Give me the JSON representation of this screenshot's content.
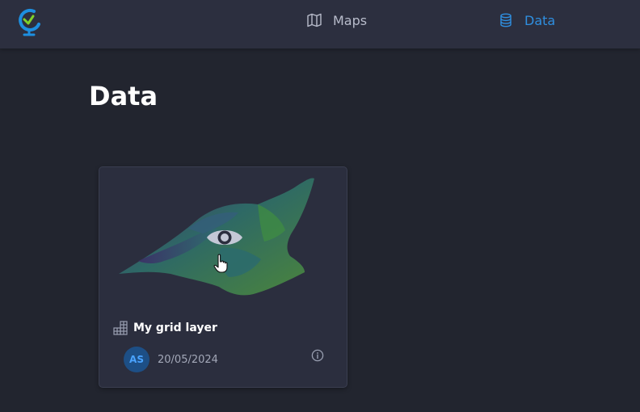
{
  "nav": {
    "items": [
      {
        "label": "Maps",
        "icon": "map-icon"
      },
      {
        "label": "Data",
        "icon": "database-icon",
        "active": true
      }
    ]
  },
  "page": {
    "title": "Data"
  },
  "card": {
    "name": "My grid layer",
    "avatar_initials": "AS",
    "date": "20/05/2024",
    "layer_icon": "grid-icon"
  },
  "colors": {
    "accent": "#2f8fe0",
    "background": "#22252f",
    "topbar": "#2c2f3f",
    "card": "#2b2e3e"
  }
}
